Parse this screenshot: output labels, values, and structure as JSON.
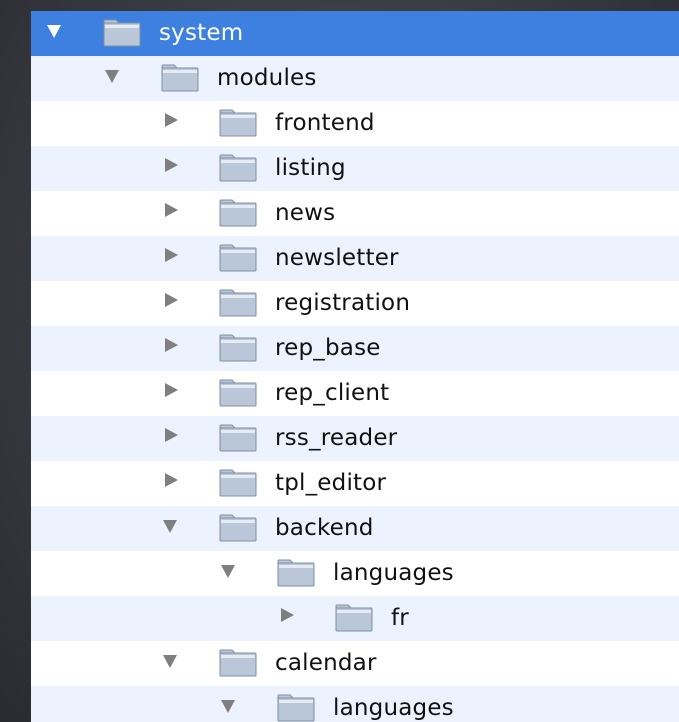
{
  "tree": {
    "items": [
      {
        "label": "system",
        "depth": 0,
        "expanded": true,
        "selected": true,
        "icon": "folder-icon"
      },
      {
        "label": "modules",
        "depth": 1,
        "expanded": true,
        "selected": false,
        "icon": "folder-icon"
      },
      {
        "label": "frontend",
        "depth": 2,
        "expanded": false,
        "selected": false,
        "icon": "folder-icon"
      },
      {
        "label": "listing",
        "depth": 2,
        "expanded": false,
        "selected": false,
        "icon": "folder-icon"
      },
      {
        "label": "news",
        "depth": 2,
        "expanded": false,
        "selected": false,
        "icon": "folder-icon"
      },
      {
        "label": "newsletter",
        "depth": 2,
        "expanded": false,
        "selected": false,
        "icon": "folder-icon"
      },
      {
        "label": "registration",
        "depth": 2,
        "expanded": false,
        "selected": false,
        "icon": "folder-icon"
      },
      {
        "label": "rep_base",
        "depth": 2,
        "expanded": false,
        "selected": false,
        "icon": "folder-icon"
      },
      {
        "label": "rep_client",
        "depth": 2,
        "expanded": false,
        "selected": false,
        "icon": "folder-icon"
      },
      {
        "label": "rss_reader",
        "depth": 2,
        "expanded": false,
        "selected": false,
        "icon": "folder-icon"
      },
      {
        "label": "tpl_editor",
        "depth": 2,
        "expanded": false,
        "selected": false,
        "icon": "folder-icon"
      },
      {
        "label": "backend",
        "depth": 2,
        "expanded": true,
        "selected": false,
        "icon": "folder-icon"
      },
      {
        "label": "languages",
        "depth": 3,
        "expanded": true,
        "selected": false,
        "icon": "folder-icon"
      },
      {
        "label": "fr",
        "depth": 4,
        "expanded": false,
        "selected": false,
        "icon": "folder-icon"
      },
      {
        "label": "calendar",
        "depth": 2,
        "expanded": true,
        "selected": false,
        "icon": "folder-icon"
      },
      {
        "label": "languages",
        "depth": 3,
        "expanded": true,
        "selected": false,
        "icon": "folder-icon"
      }
    ]
  },
  "colors": {
    "selection": "#3d80df",
    "alternate_row": "#edf3fe",
    "folder_fill": "#b9c7d8",
    "folder_edge": "#7f8fa3"
  }
}
